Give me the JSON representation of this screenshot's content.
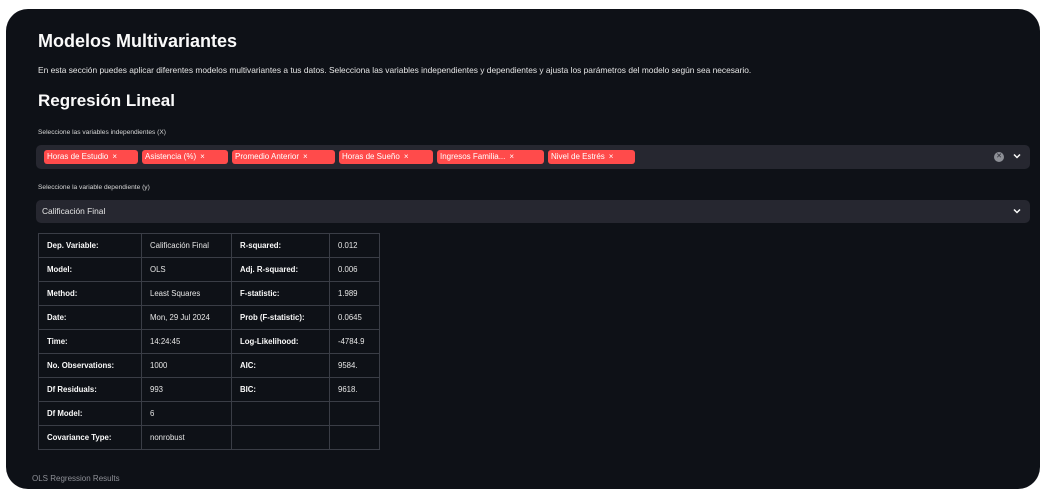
{
  "page": {
    "title": "Modelos Multivariantes",
    "intro": "En esta sección puedes aplicar diferentes modelos multivariantes a tus datos. Selecciona las variables independientes y dependientes y ajusta los parámetros del modelo según sea necesario.",
    "subtitle": "Regresión Lineal"
  },
  "independent": {
    "label": "Seleccione las variables independientes (X)",
    "tags": [
      {
        "label": "Horas de Estudio"
      },
      {
        "label": "Asistencia (%)"
      },
      {
        "label": "Promedio Anterior"
      },
      {
        "label": "Horas de Sueño"
      },
      {
        "label": "Ingresos Familia..."
      },
      {
        "label": "Nivel de Estrés"
      }
    ],
    "remove_symbol": "×"
  },
  "dependent": {
    "label": "Seleccione la variable dependiente (y)",
    "value": "Calificación Final"
  },
  "summary": {
    "rows": [
      {
        "k1": "Dep. Variable:",
        "v1": "Calificación Final",
        "k2": "R-squared:",
        "v2": "0.012"
      },
      {
        "k1": "Model:",
        "v1": "OLS",
        "k2": "Adj. R-squared:",
        "v2": "0.006"
      },
      {
        "k1": "Method:",
        "v1": "Least Squares",
        "k2": "F-statistic:",
        "v2": "1.989"
      },
      {
        "k1": "Date:",
        "v1": "Mon, 29 Jul 2024",
        "k2": "Prob (F-statistic):",
        "v2": "0.0645"
      },
      {
        "k1": "Time:",
        "v1": "14:24:45",
        "k2": "Log-Likelihood:",
        "v2": "-4784.9"
      },
      {
        "k1": "No. Observations:",
        "v1": "1000",
        "k2": "AIC:",
        "v2": "9584."
      },
      {
        "k1": "Df Residuals:",
        "v1": "993",
        "k2": "BIC:",
        "v2": "9618."
      },
      {
        "k1": "Df Model:",
        "v1": "6",
        "k2": "",
        "v2": ""
      },
      {
        "k1": "Covariance Type:",
        "v1": "nonrobust",
        "k2": "",
        "v2": ""
      }
    ],
    "caption": "OLS Regression Results"
  },
  "colors": {
    "background": "#0e1117",
    "widget": "#262730",
    "tag": "#ff4b4b",
    "text": "#fafafa"
  },
  "icons": {
    "clear": "clear-all-icon",
    "chevron": "chevron-down-icon"
  }
}
